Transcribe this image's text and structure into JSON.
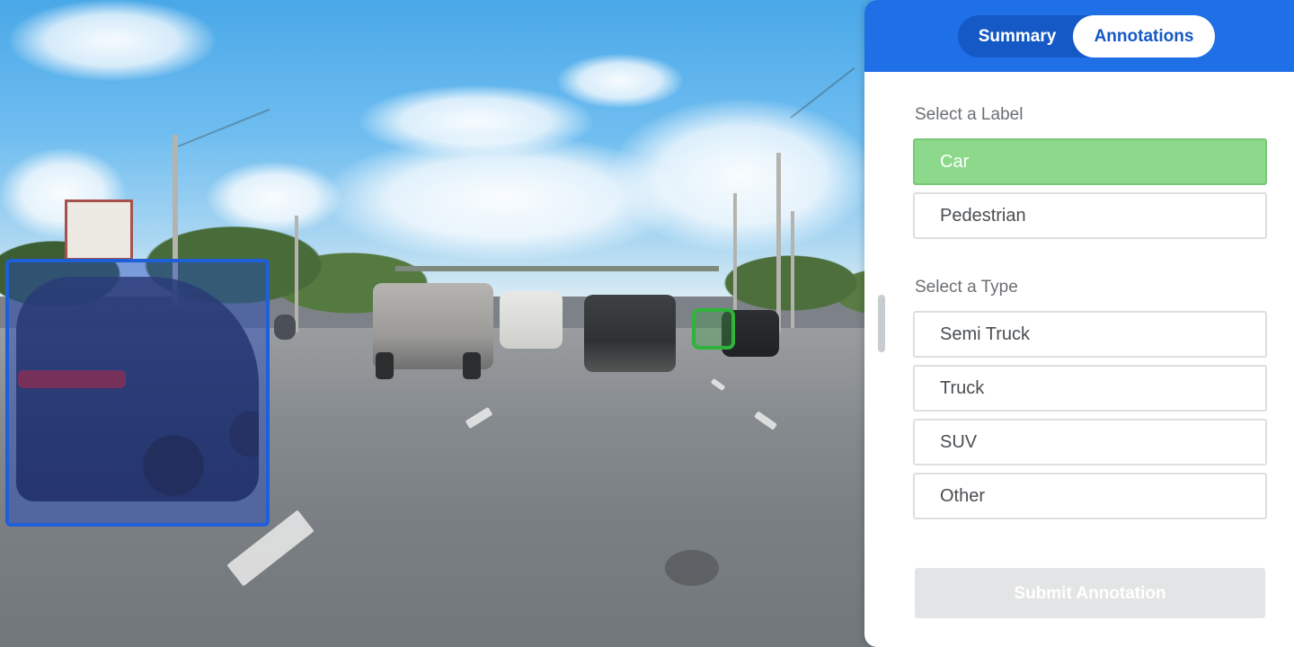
{
  "tabs": {
    "summary_label": "Summary",
    "annotations_label": "Annotations",
    "active": "Annotations"
  },
  "label_section": {
    "heading": "Select a Label",
    "options": [
      "Car",
      "Pedestrian"
    ],
    "selected": "Car"
  },
  "type_section": {
    "heading": "Select a Type",
    "options": [
      "Semi Truck",
      "Truck",
      "SUV",
      "Other"
    ],
    "selected": null
  },
  "submit_label": "Submit Annotation",
  "colors": {
    "header": "#1f6fe6",
    "selected_option": "#8dd98b",
    "bbox_primary": "#1f5fd8",
    "bbox_secondary": "#2fb33b",
    "submit_disabled": "#e3e4e5"
  },
  "icons": {
    "scrollbar": "scroll-handle"
  }
}
